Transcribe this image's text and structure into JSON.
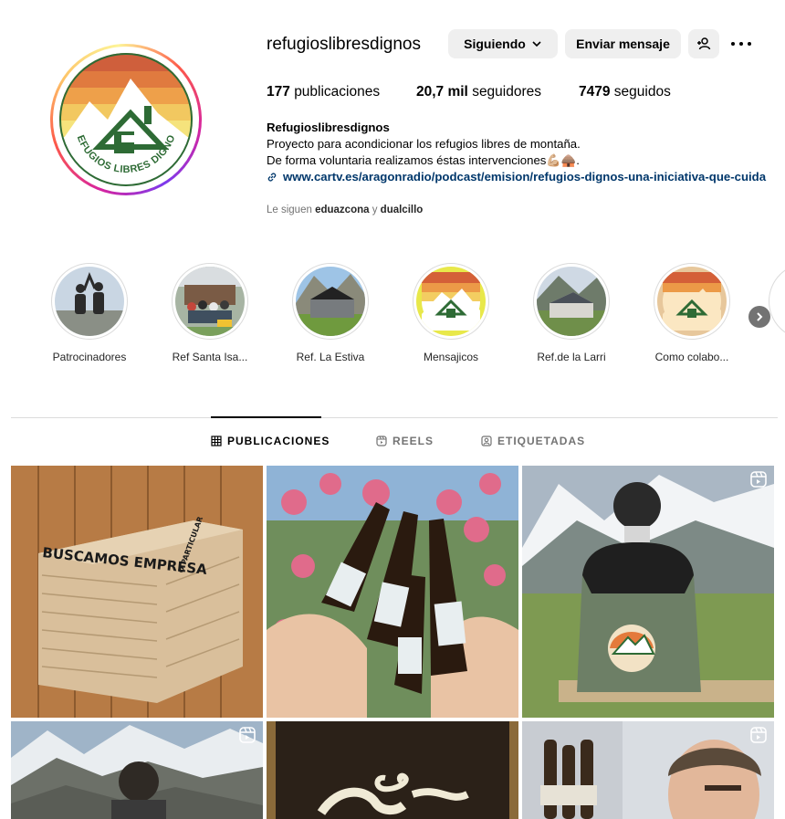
{
  "profile": {
    "username": "refugioslibresdignos",
    "follow_label": "Siguiendo",
    "message_label": "Enviar mensaje",
    "posts_count": "177",
    "posts_label": "publicaciones",
    "followers_count": "20,7 mil",
    "followers_label": "seguidores",
    "following_count": "7479",
    "following_label": "seguidos",
    "bio_name": "Refugioslibresdignos",
    "bio_line1": "Proyecto para acondicionar los refugios libres de montaña.",
    "bio_line2": "De forma voluntaria realizamos éstas intervenciones💪🏼🛖.",
    "link": "www.cartv.es/aragonradio/podcast/emision/refugios-dignos-una-iniciativa-que-cuida",
    "followed_prefix": "Le siguen",
    "followed_user1": "eduazcona",
    "followed_and": "y",
    "followed_user2": "dualcillo",
    "logo_text": "REFUGIOS LIBRES DIGNOS"
  },
  "highlights": [
    {
      "label": "Patrocinadores"
    },
    {
      "label": "Ref Santa Isa..."
    },
    {
      "label": "Ref. La Estiva"
    },
    {
      "label": "Mensajicos"
    },
    {
      "label": "Ref.de la Larri"
    },
    {
      "label": "Como colabo..."
    }
  ],
  "tabs": [
    {
      "label": "PUBLICACIONES",
      "icon": "grid-icon",
      "active": true
    },
    {
      "label": "REELS",
      "icon": "reels-icon",
      "active": false
    },
    {
      "label": "ETIQUETADAS",
      "icon": "tagged-icon",
      "active": false
    }
  ],
  "posts": {
    "post1_text_main": "BUSCAMOS EMPRESA",
    "post1_text_side": "O PARTICULAR"
  },
  "colors": {
    "link": "#00376b",
    "button_bg": "#efefef",
    "muted": "#737373",
    "logo_green": "#2e6b35"
  }
}
